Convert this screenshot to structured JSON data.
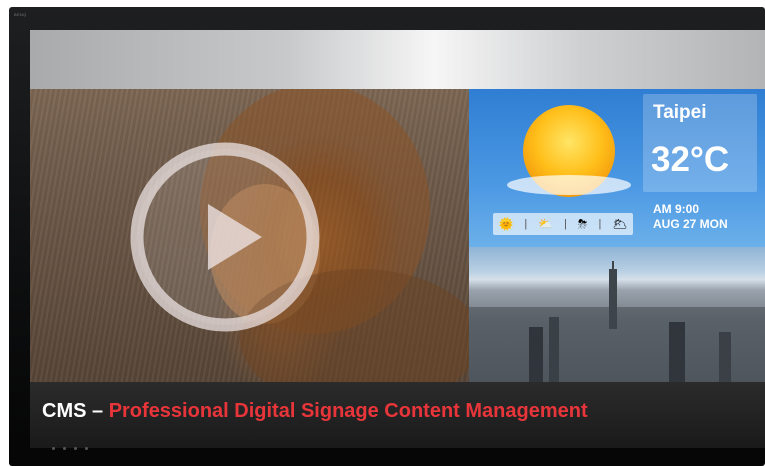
{
  "monitor": {
    "brand": "BENQ"
  },
  "weather": {
    "city": "Taipei",
    "temperature": "32°C",
    "time": "AM 9:00",
    "date": "AUG 27 MON",
    "forecast_icons": [
      "sun-icon",
      "partly-cloudy-icon",
      "rain-thunder-icon",
      "cloudy-icon"
    ],
    "separator": "|"
  },
  "caption": {
    "prefix": "CMS –",
    "highlight": "Professional Digital Signage Content Management"
  },
  "colors": {
    "highlight": "#e8353a",
    "weather_bg": "#3f8ddb",
    "caption_bg": "#222223"
  }
}
